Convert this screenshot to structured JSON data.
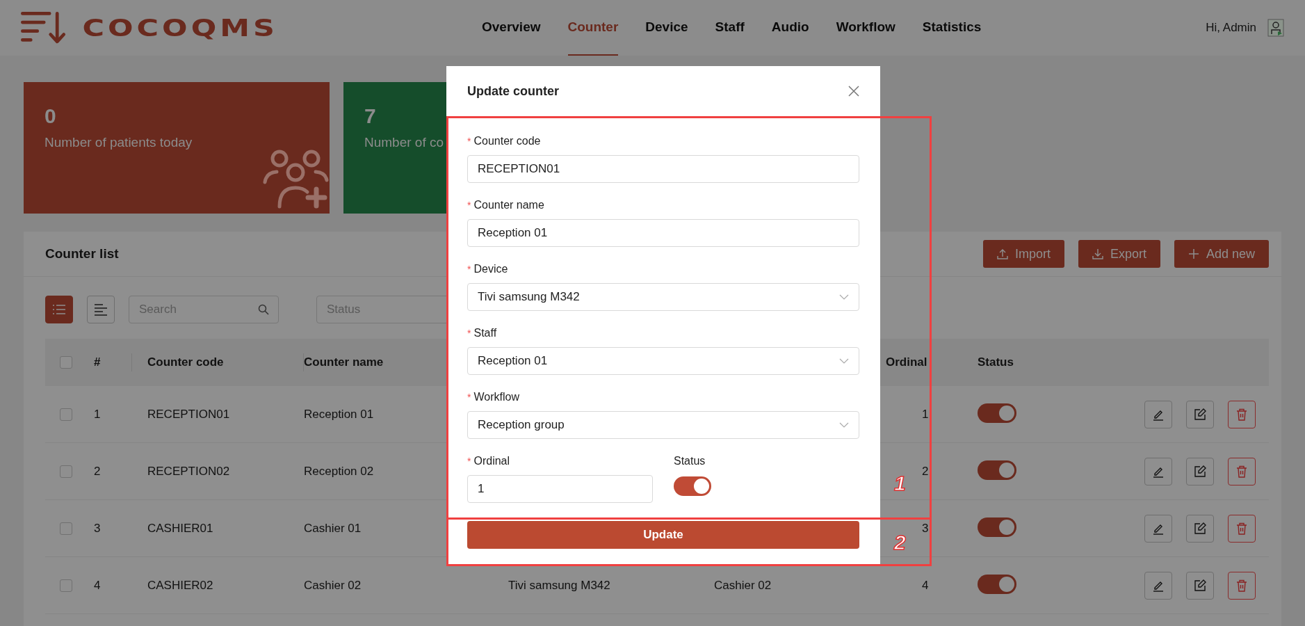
{
  "header": {
    "logo_text": "COCOQMS",
    "nav": [
      {
        "label": "Overview",
        "selected": false
      },
      {
        "label": "Counter",
        "selected": true
      },
      {
        "label": "Device",
        "selected": false
      },
      {
        "label": "Staff",
        "selected": false
      },
      {
        "label": "Audio",
        "selected": false
      },
      {
        "label": "Workflow",
        "selected": false
      },
      {
        "label": "Statistics",
        "selected": false
      }
    ],
    "greeting": "Hi, Admin"
  },
  "stat_cards": [
    {
      "value": "0",
      "label": "Number of patients today",
      "kind": "patients",
      "color": "#6a2a1e"
    },
    {
      "value": "7",
      "label": "Number of co",
      "kind": "plain",
      "color": "#154d2b"
    }
  ],
  "counter_list": {
    "title": "Counter list",
    "actions": [
      {
        "label": "Import",
        "kind": "import"
      },
      {
        "label": "Export",
        "kind": "export"
      },
      {
        "label": "Add new",
        "kind": "add"
      }
    ],
    "view_toggles": [
      {
        "kind": "list",
        "selected": true
      },
      {
        "kind": "align",
        "selected": false
      }
    ],
    "search": {
      "placeholder": "Search"
    },
    "status_filter": {
      "placeholder": "Status"
    },
    "table": {
      "header": {
        "checked": false,
        "index": "#",
        "code": "Counter code",
        "name": "Counter name",
        "ordinal": "Ordinal",
        "status": "Status"
      },
      "rows": [
        {
          "checked": false,
          "index": "1",
          "code": "RECEPTION01",
          "name": "Reception 01",
          "ordinal": "1",
          "on": true
        },
        {
          "checked": false,
          "index": "2",
          "code": "RECEPTION02",
          "name": "Reception 02",
          "ordinal": "2",
          "on": true
        },
        {
          "checked": false,
          "index": "3",
          "code": "CASHIER01",
          "name": "Cashier 01",
          "ordinal": "3",
          "on": true
        },
        {
          "checked": false,
          "index": "4",
          "code": "CASHIER02",
          "name": "Cashier 02",
          "device": "Tivi samsung M342",
          "staff": "Cashier 02",
          "ordinal": "4",
          "on": true
        }
      ]
    }
  },
  "modal": {
    "title": "Update counter",
    "fields": [
      {
        "label": "Counter code",
        "required_mark": "*",
        "kind": "text",
        "value": "RECEPTION01"
      },
      {
        "label": "Counter name",
        "required_mark": "*",
        "kind": "text",
        "value": "Reception 01"
      },
      {
        "label": "Device",
        "required_mark": "*",
        "kind": "select",
        "value": "Tivi samsung M342"
      },
      {
        "label": "Staff",
        "required_mark": "*",
        "kind": "select",
        "value": "Reception 01"
      },
      {
        "label": "Workflow",
        "required_mark": "*",
        "kind": "select",
        "value": "Reception group"
      }
    ],
    "ordinal": {
      "label": "Ordinal",
      "required_mark": "*",
      "value": "1"
    },
    "status": {
      "label": "Status",
      "on": true
    },
    "submit": "Update"
  },
  "annotations": [
    {
      "label": "1"
    },
    {
      "label": "2"
    }
  ]
}
